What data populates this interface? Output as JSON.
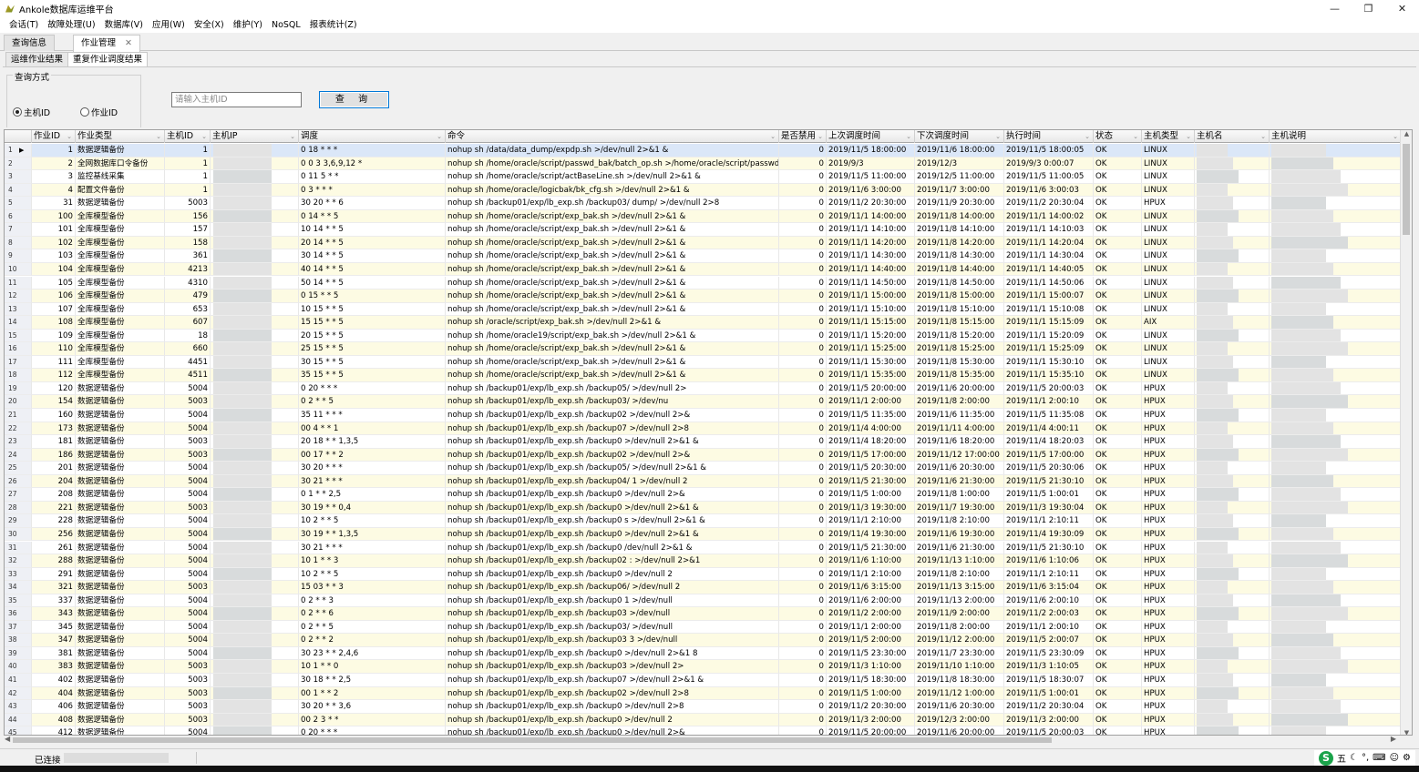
{
  "window": {
    "title": "Ankole数据库运维平台"
  },
  "menu": [
    "会话(T)",
    "故障处理(U)",
    "数据库(V)",
    "应用(W)",
    "安全(X)",
    "维护(Y)",
    "NoSQL",
    "报表统计(Z)"
  ],
  "tabs": [
    {
      "label": "查询信息"
    },
    {
      "label": "作业管理"
    }
  ],
  "subtabs": [
    {
      "label": "运维作业结果"
    },
    {
      "label": "重复作业调度结果"
    }
  ],
  "query": {
    "group_title": "查询方式",
    "radio_host": "主机ID",
    "radio_job": "作业ID",
    "input_placeholder": "请输入主机ID",
    "button_label": "查 询"
  },
  "columns": [
    "作业ID",
    "作业类型",
    "主机ID",
    "主机IP",
    "调度",
    "命令",
    "是否禁用",
    "上次调度时间",
    "下次调度时间",
    "执行时间",
    "状态",
    "主机类型",
    "主机名",
    "主机说明"
  ],
  "rows": [
    {
      "n": "1",
      "id": "1",
      "type": "数据逻辑备份",
      "hid": "1",
      "sched": "0 18 * * *",
      "cmd": "nohup sh /data/data_dump/expdp.sh >/dev/null 2>&1 &",
      "dis": "0",
      "last": "2019/11/5 18:00:00",
      "next": "2019/11/6 18:00:00",
      "exec": "2019/11/5 18:00:05",
      "st": "OK",
      "os": "LINUX"
    },
    {
      "n": "2",
      "id": "2",
      "type": "全网数据库口令备份",
      "hid": "1",
      "sched": "0 0 3 3,6,9,12 *",
      "cmd": "nohup sh /home/oracle/script/passwd_bak/batch_op.sh >/home/oracle/script/passwd_bak/ba",
      "dis": "0",
      "last": "2019/9/3",
      "next": "2019/12/3",
      "exec": "2019/9/3 0:00:07",
      "st": "OK",
      "os": "LINUX"
    },
    {
      "n": "3",
      "id": "3",
      "type": "监控基线采集",
      "hid": "1",
      "sched": "0 11 5 * *",
      "cmd": "nohup sh /home/oracle/script/actBaseLine.sh >/dev/null 2>&1 &",
      "dis": "0",
      "last": "2019/11/5 11:00:00",
      "next": "2019/12/5 11:00:00",
      "exec": "2019/11/5 11:00:05",
      "st": "OK",
      "os": "LINUX"
    },
    {
      "n": "4",
      "id": "4",
      "type": "配置文件备份",
      "hid": "1",
      "sched": "0 3 * * *",
      "cmd": "nohup sh /home/oracle/logicbak/bk_cfg.sh >/dev/null 2>&1 &",
      "dis": "0",
      "last": "2019/11/6 3:00:00",
      "next": "2019/11/7 3:00:00",
      "exec": "2019/11/6 3:00:03",
      "st": "OK",
      "os": "LINUX"
    },
    {
      "n": "5",
      "id": "31",
      "type": "数据逻辑备份",
      "hid": "5003",
      "sched": "30 20 * * 6",
      "cmd": "nohup sh /backup01/exp/lb_exp.sh /backup03/            dump/                  >/dev/null 2>8",
      "dis": "0",
      "last": "2019/11/2 20:30:00",
      "next": "2019/11/9 20:30:00",
      "exec": "2019/11/2 20:30:04",
      "st": "OK",
      "os": "HPUX"
    },
    {
      "n": "6",
      "id": "100",
      "type": "全库模型备份",
      "hid": "156",
      "sched": "0 14 * * 5",
      "cmd": "nohup sh /home/oracle/script/exp_bak.sh >/dev/null 2>&1 &",
      "dis": "0",
      "last": "2019/11/1 14:00:00",
      "next": "2019/11/8 14:00:00",
      "exec": "2019/11/1 14:00:02",
      "st": "OK",
      "os": "LINUX"
    },
    {
      "n": "7",
      "id": "101",
      "type": "全库模型备份",
      "hid": "157",
      "sched": "10 14 * * 5",
      "cmd": "nohup sh /home/oracle/script/exp_bak.sh >/dev/null 2>&1 &",
      "dis": "0",
      "last": "2019/11/1 14:10:00",
      "next": "2019/11/8 14:10:00",
      "exec": "2019/11/1 14:10:03",
      "st": "OK",
      "os": "LINUX"
    },
    {
      "n": "8",
      "id": "102",
      "type": "全库模型备份",
      "hid": "158",
      "sched": "20 14 * * 5",
      "cmd": "nohup sh /home/oracle/script/exp_bak.sh >/dev/null 2>&1 &",
      "dis": "0",
      "last": "2019/11/1 14:20:00",
      "next": "2019/11/8 14:20:00",
      "exec": "2019/11/1 14:20:04",
      "st": "OK",
      "os": "LINUX"
    },
    {
      "n": "9",
      "id": "103",
      "type": "全库模型备份",
      "hid": "361",
      "sched": "30 14 * * 5",
      "cmd": "nohup sh /home/oracle/script/exp_bak.sh >/dev/null 2>&1 &",
      "dis": "0",
      "last": "2019/11/1 14:30:00",
      "next": "2019/11/8 14:30:00",
      "exec": "2019/11/1 14:30:04",
      "st": "OK",
      "os": "LINUX"
    },
    {
      "n": "10",
      "id": "104",
      "type": "全库模型备份",
      "hid": "4213",
      "sched": "40 14 * * 5",
      "cmd": "nohup sh /home/oracle/script/exp_bak.sh >/dev/null 2>&1 &",
      "dis": "0",
      "last": "2019/11/1 14:40:00",
      "next": "2019/11/8 14:40:00",
      "exec": "2019/11/1 14:40:05",
      "st": "OK",
      "os": "LINUX"
    },
    {
      "n": "11",
      "id": "105",
      "type": "全库模型备份",
      "hid": "4310",
      "sched": "50 14 * * 5",
      "cmd": "nohup sh /home/oracle/script/exp_bak.sh >/dev/null 2>&1 &",
      "dis": "0",
      "last": "2019/11/1 14:50:00",
      "next": "2019/11/8 14:50:00",
      "exec": "2019/11/1 14:50:06",
      "st": "OK",
      "os": "LINUX"
    },
    {
      "n": "12",
      "id": "106",
      "type": "全库模型备份",
      "hid": "479",
      "sched": "0 15 * * 5",
      "cmd": "nohup sh /home/oracle/script/exp_bak.sh >/dev/null 2>&1 &",
      "dis": "0",
      "last": "2019/11/1 15:00:00",
      "next": "2019/11/8 15:00:00",
      "exec": "2019/11/1 15:00:07",
      "st": "OK",
      "os": "LINUX"
    },
    {
      "n": "13",
      "id": "107",
      "type": "全库模型备份",
      "hid": "653",
      "sched": "10 15 * * 5",
      "cmd": "nohup sh /home/oracle/script/exp_bak.sh >/dev/null 2>&1 &",
      "dis": "0",
      "last": "2019/11/1 15:10:00",
      "next": "2019/11/8 15:10:00",
      "exec": "2019/11/1 15:10:08",
      "st": "OK",
      "os": "LINUX"
    },
    {
      "n": "14",
      "id": "108",
      "type": "全库模型备份",
      "hid": "607",
      "sched": "15 15 * * 5",
      "cmd": "nohup sh /oracle/script/exp_bak.sh >/dev/null 2>&1 &",
      "dis": "0",
      "last": "2019/11/1 15:15:00",
      "next": "2019/11/8 15:15:00",
      "exec": "2019/11/1 15:15:09",
      "st": "OK",
      "os": "AIX"
    },
    {
      "n": "15",
      "id": "109",
      "type": "全库模型备份",
      "hid": "18",
      "sched": "20 15 * * 5",
      "cmd": "nohup sh /home/oracle19/script/exp_bak.sh >/dev/null 2>&1 &",
      "dis": "0",
      "last": "2019/11/1 15:20:00",
      "next": "2019/11/8 15:20:00",
      "exec": "2019/11/1 15:20:09",
      "st": "OK",
      "os": "LINUX"
    },
    {
      "n": "16",
      "id": "110",
      "type": "全库模型备份",
      "hid": "660",
      "sched": "25 15 * * 5",
      "cmd": "nohup sh /home/oracle/script/exp_bak.sh >/dev/null 2>&1 &",
      "dis": "0",
      "last": "2019/11/1 15:25:00",
      "next": "2019/11/8 15:25:00",
      "exec": "2019/11/1 15:25:09",
      "st": "OK",
      "os": "LINUX"
    },
    {
      "n": "17",
      "id": "111",
      "type": "全库模型备份",
      "hid": "4451",
      "sched": "30 15 * * 5",
      "cmd": "nohup sh /home/oracle/script/exp_bak.sh >/dev/null 2>&1 &",
      "dis": "0",
      "last": "2019/11/1 15:30:00",
      "next": "2019/11/8 15:30:00",
      "exec": "2019/11/1 15:30:10",
      "st": "OK",
      "os": "LINUX"
    },
    {
      "n": "18",
      "id": "112",
      "type": "全库模型备份",
      "hid": "4511",
      "sched": "35 15 * * 5",
      "cmd": "nohup sh /home/oracle/script/exp_bak.sh >/dev/null 2>&1 &",
      "dis": "0",
      "last": "2019/11/1 15:35:00",
      "next": "2019/11/8 15:35:00",
      "exec": "2019/11/1 15:35:10",
      "st": "OK",
      "os": "LINUX"
    },
    {
      "n": "19",
      "id": "120",
      "type": "数据逻辑备份",
      "hid": "5004",
      "sched": "0 20 * * *",
      "cmd": "nohup sh /backup01/exp/lb_exp.sh /backup05/                                >/dev/null 2>",
      "dis": "0",
      "last": "2019/11/5 20:00:00",
      "next": "2019/11/6 20:00:00",
      "exec": "2019/11/5 20:00:03",
      "st": "OK",
      "os": "HPUX"
    },
    {
      "n": "20",
      "id": "154",
      "type": "数据逻辑备份",
      "hid": "5003",
      "sched": "0 2 * * 5",
      "cmd": "nohup sh /backup01/exp/lb_exp.sh /backup03/                                 >/dev/nu",
      "dis": "0",
      "last": "2019/11/1 2:00:00",
      "next": "2019/11/8 2:00:00",
      "exec": "2019/11/1 2:00:10",
      "st": "OK",
      "os": "HPUX"
    },
    {
      "n": "21",
      "id": "160",
      "type": "数据逻辑备份",
      "hid": "5004",
      "sched": "35 11 * * *",
      "cmd": "nohup sh /backup01/exp/lb_exp.sh /backup02                                  >/dev/null 2>&",
      "dis": "0",
      "last": "2019/11/5 11:35:00",
      "next": "2019/11/6 11:35:00",
      "exec": "2019/11/5 11:35:08",
      "st": "OK",
      "os": "HPUX"
    },
    {
      "n": "22",
      "id": "173",
      "type": "数据逻辑备份",
      "hid": "5004",
      "sched": "00 4 * * 1",
      "cmd": "nohup sh /backup01/exp/lb_exp.sh /backup07                                  >/dev/null 2>8",
      "dis": "0",
      "last": "2019/11/4 4:00:00",
      "next": "2019/11/11 4:00:00",
      "exec": "2019/11/4 4:00:11",
      "st": "OK",
      "os": "HPUX"
    },
    {
      "n": "23",
      "id": "181",
      "type": "数据逻辑备份",
      "hid": "5003",
      "sched": "20 18 * * 1,3,5",
      "cmd": "nohup sh /backup01/exp/lb_exp.sh /backup0                              >/dev/null 2>&1 &",
      "dis": "0",
      "last": "2019/11/4 18:20:00",
      "next": "2019/11/6 18:20:00",
      "exec": "2019/11/4 18:20:03",
      "st": "OK",
      "os": "HPUX"
    },
    {
      "n": "24",
      "id": "186",
      "type": "数据逻辑备份",
      "hid": "5003",
      "sched": "00 17 * * 2",
      "cmd": "nohup sh /backup01/exp/lb_exp.sh /backup02                                  >/dev/null 2>&",
      "dis": "0",
      "last": "2019/11/5 17:00:00",
      "next": "2019/11/12 17:00:00",
      "exec": "2019/11/5 17:00:00",
      "st": "OK",
      "os": "HPUX"
    },
    {
      "n": "25",
      "id": "201",
      "type": "数据逻辑备份",
      "hid": "5004",
      "sched": "30 20 * * *",
      "cmd": "nohup sh /backup01/exp/lb_exp.sh /backup05/                           >/dev/null 2>&1 &",
      "dis": "0",
      "last": "2019/11/5 20:30:00",
      "next": "2019/11/6 20:30:00",
      "exec": "2019/11/5 20:30:06",
      "st": "OK",
      "os": "HPUX"
    },
    {
      "n": "26",
      "id": "204",
      "type": "数据逻辑备份",
      "hid": "5004",
      "sched": "30 21 * * *",
      "cmd": "nohup sh /backup01/exp/lb_exp.sh /backup04/                                  1 >/dev/null 2",
      "dis": "0",
      "last": "2019/11/5 21:30:00",
      "next": "2019/11/6 21:30:00",
      "exec": "2019/11/5 21:30:10",
      "st": "OK",
      "os": "HPUX"
    },
    {
      "n": "27",
      "id": "208",
      "type": "数据逻辑备份",
      "hid": "5004",
      "sched": "0 1 * * 2,5",
      "cmd": "nohup sh /backup01/exp/lb_exp.sh /backup0                                   >/dev/null 2>&",
      "dis": "0",
      "last": "2019/11/5 1:00:00",
      "next": "2019/11/8 1:00:00",
      "exec": "2019/11/5 1:00:01",
      "st": "OK",
      "os": "HPUX"
    },
    {
      "n": "28",
      "id": "221",
      "type": "数据逻辑备份",
      "hid": "5003",
      "sched": "30 19 * * 0,4",
      "cmd": "nohup sh /backup01/exp/lb_exp.sh /backup0                            >/dev/null 2>&1 &",
      "dis": "0",
      "last": "2019/11/3 19:30:00",
      "next": "2019/11/7 19:30:00",
      "exec": "2019/11/3 19:30:04",
      "st": "OK",
      "os": "HPUX"
    },
    {
      "n": "29",
      "id": "228",
      "type": "数据逻辑备份",
      "hid": "5004",
      "sched": "10 2 * * 5",
      "cmd": "nohup sh /backup01/exp/lb_exp.sh /backup0                                 s >/dev/null 2>&1 &",
      "dis": "0",
      "last": "2019/11/1 2:10:00",
      "next": "2019/11/8 2:10:00",
      "exec": "2019/11/1 2:10:11",
      "st": "OK",
      "os": "HPUX"
    },
    {
      "n": "30",
      "id": "256",
      "type": "数据逻辑备份",
      "hid": "5004",
      "sched": "30 19 * * 1,3,5",
      "cmd": "nohup sh /backup01/exp/lb_exp.sh /backup0                                   >/dev/null 2>&1 &",
      "dis": "0",
      "last": "2019/11/4 19:30:00",
      "next": "2019/11/6 19:30:00",
      "exec": "2019/11/4 19:30:09",
      "st": "OK",
      "os": "HPUX"
    },
    {
      "n": "31",
      "id": "261",
      "type": "数据逻辑备份",
      "hid": "5004",
      "sched": "30 21 * * *",
      "cmd": "nohup sh /backup01/exp/lb_exp.sh /backup0                                  /dev/null 2>&1 &",
      "dis": "0",
      "last": "2019/11/5 21:30:00",
      "next": "2019/11/6 21:30:00",
      "exec": "2019/11/5 21:30:10",
      "st": "OK",
      "os": "HPUX"
    },
    {
      "n": "32",
      "id": "288",
      "type": "数据逻辑备份",
      "hid": "5004",
      "sched": "10 1 * * 3",
      "cmd": "nohup sh /backup01/exp/lb_exp.sh /backup02                                  : >/dev/null 2>&1",
      "dis": "0",
      "last": "2019/11/6 1:10:00",
      "next": "2019/11/13 1:10:00",
      "exec": "2019/11/6 1:10:06",
      "st": "OK",
      "os": "HPUX"
    },
    {
      "n": "33",
      "id": "291",
      "type": "数据逻辑备份",
      "hid": "5004",
      "sched": "10 2 * * 5",
      "cmd": "nohup sh /backup01/exp/lb_exp.sh /backup0                                    >/dev/null 2",
      "dis": "0",
      "last": "2019/11/1 2:10:00",
      "next": "2019/11/8 2:10:00",
      "exec": "2019/11/1 2:10:11",
      "st": "OK",
      "os": "HPUX"
    },
    {
      "n": "34",
      "id": "321",
      "type": "数据逻辑备份",
      "hid": "5003",
      "sched": "15 03 * * 3",
      "cmd": "nohup sh /backup01/exp/lb_exp.sh /backup06/                                  >/dev/null 2",
      "dis": "0",
      "last": "2019/11/6 3:15:00",
      "next": "2019/11/13 3:15:00",
      "exec": "2019/11/6 3:15:04",
      "st": "OK",
      "os": "HPUX"
    },
    {
      "n": "35",
      "id": "337",
      "type": "数据逻辑备份",
      "hid": "5004",
      "sched": "0 2 * * 3",
      "cmd": "nohup sh /backup01/exp/lb_exp.sh /backup0                                     1 >/dev/null",
      "dis": "0",
      "last": "2019/11/6 2:00:00",
      "next": "2019/11/13 2:00:00",
      "exec": "2019/11/6 2:00:10",
      "st": "OK",
      "os": "HPUX"
    },
    {
      "n": "36",
      "id": "343",
      "type": "数据逻辑备份",
      "hid": "5004",
      "sched": "0 2 * * 6",
      "cmd": "nohup sh /backup01/exp/lb_exp.sh /backup03                                      >/dev/null",
      "dis": "0",
      "last": "2019/11/2 2:00:00",
      "next": "2019/11/9 2:00:00",
      "exec": "2019/11/2 2:00:03",
      "st": "OK",
      "os": "HPUX"
    },
    {
      "n": "37",
      "id": "345",
      "type": "数据逻辑备份",
      "hid": "5004",
      "sched": "0 2 * * 5",
      "cmd": "nohup sh /backup01/exp/lb_exp.sh /backup03/                                     >/dev/null",
      "dis": "0",
      "last": "2019/11/1 2:00:00",
      "next": "2019/11/8 2:00:00",
      "exec": "2019/11/1 2:00:10",
      "st": "OK",
      "os": "HPUX"
    },
    {
      "n": "38",
      "id": "347",
      "type": "数据逻辑备份",
      "hid": "5004",
      "sched": "0 2 * * 2",
      "cmd": "nohup sh /backup01/exp/lb_exp.sh /backup03                                    3 >/dev/null",
      "dis": "0",
      "last": "2019/11/5 2:00:00",
      "next": "2019/11/12 2:00:00",
      "exec": "2019/11/5 2:00:07",
      "st": "OK",
      "os": "HPUX"
    },
    {
      "n": "39",
      "id": "381",
      "type": "数据逻辑备份",
      "hid": "5004",
      "sched": "30 23 * * 2,4,6",
      "cmd": "nohup sh /backup01/exp/lb_exp.sh /backup0                                  >/dev/null 2>&1 8",
      "dis": "0",
      "last": "2019/11/5 23:30:00",
      "next": "2019/11/7 23:30:00",
      "exec": "2019/11/5 23:30:09",
      "st": "OK",
      "os": "HPUX"
    },
    {
      "n": "40",
      "id": "383",
      "type": "数据逻辑备份",
      "hid": "5003",
      "sched": "10 1 * * 0",
      "cmd": "nohup sh /backup01/exp/lb_exp.sh /backup03                                    >/dev/null 2>",
      "dis": "0",
      "last": "2019/11/3 1:10:00",
      "next": "2019/11/10 1:10:00",
      "exec": "2019/11/3 1:10:05",
      "st": "OK",
      "os": "HPUX"
    },
    {
      "n": "41",
      "id": "402",
      "type": "数据逻辑备份",
      "hid": "5003",
      "sched": "30 18 * * 2,5",
      "cmd": "nohup sh /backup01/exp/lb_exp.sh /backup07                            >/dev/null 2>&1 &",
      "dis": "0",
      "last": "2019/11/5 18:30:00",
      "next": "2019/11/8 18:30:00",
      "exec": "2019/11/5 18:30:07",
      "st": "OK",
      "os": "HPUX"
    },
    {
      "n": "42",
      "id": "404",
      "type": "数据逻辑备份",
      "hid": "5003",
      "sched": "00 1 * * 2",
      "cmd": "nohup sh /backup01/exp/lb_exp.sh /backup02                                   >/dev/null 2>8",
      "dis": "0",
      "last": "2019/11/5 1:00:00",
      "next": "2019/11/12 1:00:00",
      "exec": "2019/11/5 1:00:01",
      "st": "OK",
      "os": "HPUX"
    },
    {
      "n": "43",
      "id": "406",
      "type": "数据逻辑备份",
      "hid": "5003",
      "sched": "30 20 * * 3,6",
      "cmd": "nohup sh /backup01/exp/lb_exp.sh /backup0                                    >/dev/null 2>8",
      "dis": "0",
      "last": "2019/11/2 20:30:00",
      "next": "2019/11/6 20:30:00",
      "exec": "2019/11/2 20:30:04",
      "st": "OK",
      "os": "HPUX"
    },
    {
      "n": "44",
      "id": "408",
      "type": "数据逻辑备份",
      "hid": "5003",
      "sched": "00 2 3 * *",
      "cmd": "nohup sh /backup01/exp/lb_exp.sh /backup0                                     >/dev/null 2",
      "dis": "0",
      "last": "2019/11/3 2:00:00",
      "next": "2019/12/3 2:00:00",
      "exec": "2019/11/3 2:00:00",
      "st": "OK",
      "os": "HPUX"
    },
    {
      "n": "45",
      "id": "412",
      "type": "数据逻辑备份",
      "hid": "5004",
      "sched": "0 20 * * *",
      "cmd": "nohup sh /backup01/exp/lb_exp.sh /backup0                                   >/dev/null 2>&",
      "dis": "0",
      "last": "2019/11/5 20:00:00",
      "next": "2019/11/6 20:00:00",
      "exec": "2019/11/5 20:00:03",
      "st": "OK",
      "os": "HPUX"
    }
  ],
  "status": {
    "text": "已连接"
  },
  "ime": {
    "logo": "S",
    "mode": "五"
  }
}
